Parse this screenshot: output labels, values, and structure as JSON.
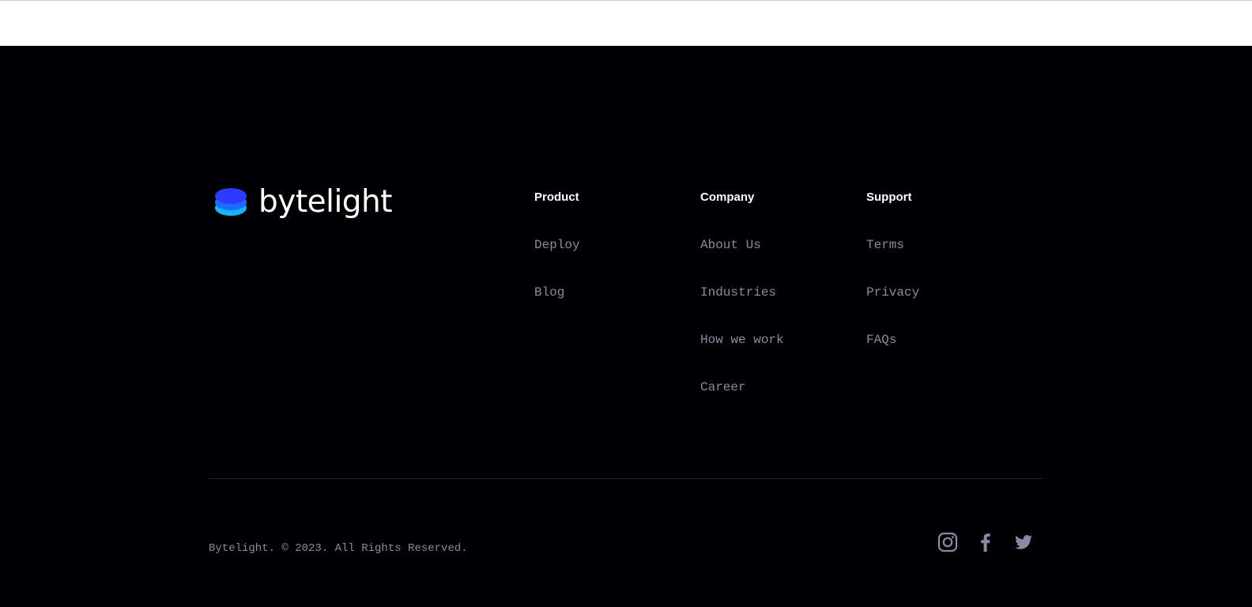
{
  "brand": {
    "name": "bytelight",
    "logo_colors": [
      "#2b3bff",
      "#1a6dff",
      "#16b4f5"
    ]
  },
  "columns": [
    {
      "heading": "Product",
      "links": [
        "Deploy",
        "Blog"
      ]
    },
    {
      "heading": "Company",
      "links": [
        "About Us",
        "Industries",
        "How we work",
        "Career"
      ]
    },
    {
      "heading": "Support",
      "links": [
        "Terms",
        "Privacy",
        "FAQs"
      ]
    }
  ],
  "copyright": "Bytelight. © 2023. All Rights Reserved.",
  "socials": [
    {
      "icon": "instagram-icon"
    },
    {
      "icon": "facebook-icon"
    },
    {
      "icon": "twitter-icon"
    }
  ],
  "colors": {
    "background": "#000004",
    "heading": "#ffffff",
    "link": "#8b8aa2",
    "divider": "#25243a"
  }
}
